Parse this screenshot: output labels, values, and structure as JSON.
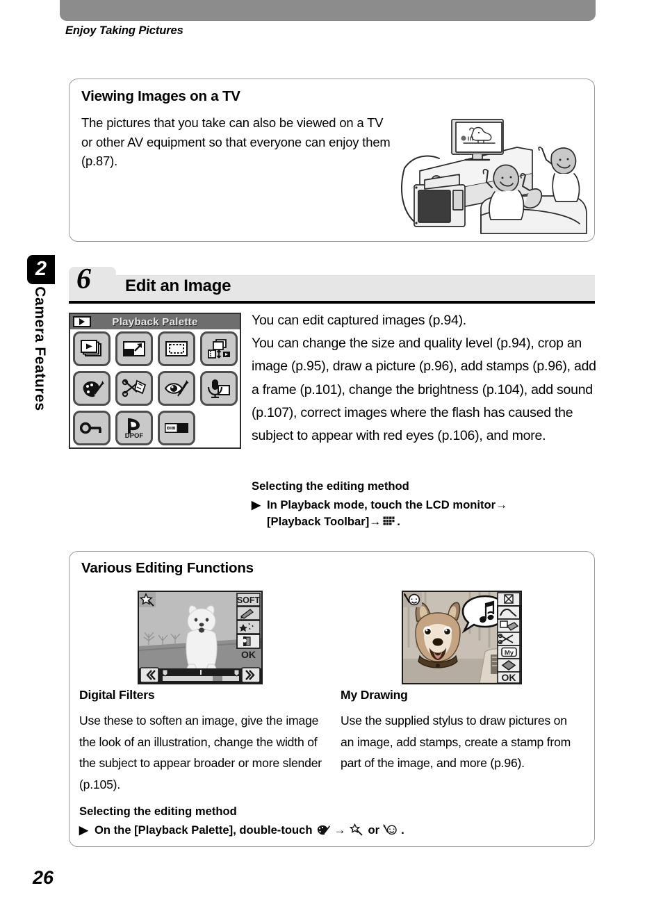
{
  "page": {
    "running_head": "Enjoy Taking Pictures",
    "page_number": "26",
    "chapter_number": "2",
    "chapter_name": "Camera Features"
  },
  "tv_panel": {
    "title": "Viewing Images on a TV",
    "body": "The pictures that you take can also be viewed on a TV or other AV equipment so that everyone can enjoy them (p.87).",
    "illustration": "people-watching-tv-illustration"
  },
  "section": {
    "number": "6",
    "title": "Edit an Image",
    "body": "You can edit captured images (p.94).\nYou can change the size and quality level (p.94), crop an image (p.95), draw a picture (p.96), add stamps (p.96), add a frame (p.101), change the brightness (p.104), add sound (p.107), correct images where the flash has caused the subject to appear with red eyes (p.106), and more.",
    "selecting": {
      "heading": "Selecting the editing method",
      "bullet": "▶",
      "step_before_arrow": "In Playback mode, touch the LCD monitor",
      "arrow": "→",
      "step_after_arrow": "[Playback Toolbar]",
      "end_period": "."
    }
  },
  "playback_palette": {
    "title": "Playback Palette",
    "mode_icon": "playback-mode-icon",
    "buttons": [
      {
        "name": "slideshow-icon"
      },
      {
        "name": "resize-icon"
      },
      {
        "name": "cropping-icon"
      },
      {
        "name": "image-copy-icon"
      },
      {
        "name": "drawing-palette-icon"
      },
      {
        "name": "image-cut-paste-icon"
      },
      {
        "name": "red-eye-compensation-icon"
      },
      {
        "name": "voice-memo-icon"
      },
      {
        "name": "protect-key-icon"
      },
      {
        "name": "dpof-icon"
      },
      {
        "name": "start-up-screen-icon"
      }
    ]
  },
  "various_panel": {
    "title": "Various Editing Functions",
    "items": [
      {
        "screen": "digital-filters-screen",
        "title": "Digital Filters",
        "body": "Use these to soften an image, give the image the look of an illustration, change the width of the subject to appear broader or more slender (p.105).",
        "screen_labels": {
          "soft": "SOFT",
          "ok": "OK"
        }
      },
      {
        "screen": "my-drawing-screen",
        "title": "My Drawing",
        "body": "Use the supplied stylus to draw pictures on an image, add stamps, create a stamp from part of the image, and more (p.96).",
        "screen_labels": {
          "my": "My",
          "ok": "OK"
        }
      }
    ],
    "selecting": {
      "heading": "Selecting the editing method",
      "bullet": "▶",
      "step_before_icon": "On the [Playback Palette], double-touch",
      "arrow": "→",
      "or_word": "or",
      "end_period": ".",
      "icon_1": "drawing-palette-icon",
      "icon_2": "digital-filter-wand-icon",
      "icon_3": "my-drawing-face-icon"
    }
  },
  "colors": {
    "topbar": "#8c8c8c",
    "section_band": "#e6e6e6",
    "panel_border": "#9a9a9a",
    "chapter_tab": "#000000"
  }
}
